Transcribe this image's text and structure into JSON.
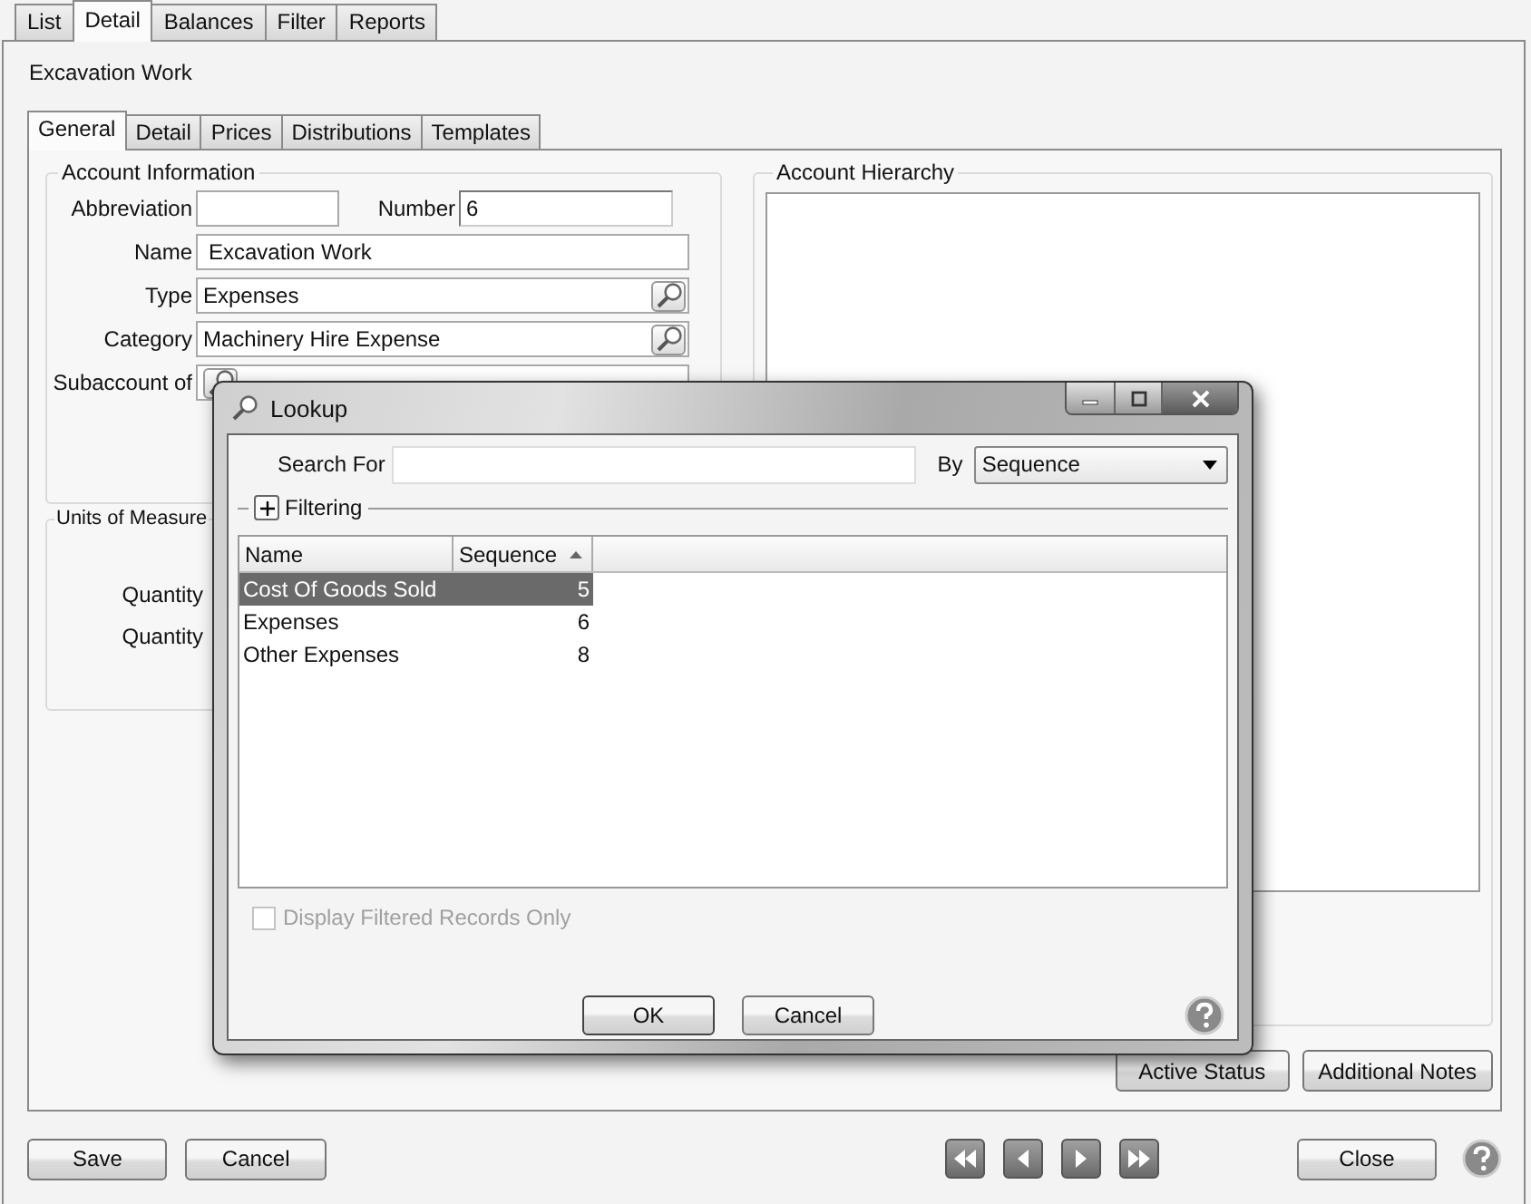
{
  "top_tabs": [
    {
      "label": "List",
      "selected": false
    },
    {
      "label": "Detail",
      "selected": true
    },
    {
      "label": "Balances",
      "selected": false
    },
    {
      "label": "Filter",
      "selected": false
    },
    {
      "label": "Reports",
      "selected": false
    }
  ],
  "record_title": "Excavation Work",
  "detail_tabs": [
    {
      "label": "General",
      "selected": true
    },
    {
      "label": "Detail",
      "selected": false
    },
    {
      "label": "Prices",
      "selected": false
    },
    {
      "label": "Distributions",
      "selected": false
    },
    {
      "label": "Templates",
      "selected": false
    }
  ],
  "account_information": {
    "title": "Account Information",
    "abbreviation": {
      "label": "Abbreviation"
    },
    "number": {
      "label": "Number",
      "value": "6"
    },
    "fields": [
      {
        "label": "Name",
        "value": "Excavation Work",
        "kind": "text"
      },
      {
        "label": "Type",
        "value": "Expenses",
        "kind": "lookup"
      },
      {
        "label": "Category",
        "value": "Machinery Hire Expense",
        "kind": "lookup"
      },
      {
        "label": "Subaccount of",
        "kind": "lookup"
      }
    ]
  },
  "units_of_measure": {
    "title": "Units of Measure",
    "labels": [
      "Quantity",
      "Quantity"
    ]
  },
  "account_hierarchy": {
    "title": "Account Hierarchy"
  },
  "side_buttons": [
    "Active Status",
    "Additional Notes"
  ],
  "footer_buttons": [
    "Save",
    "Cancel"
  ],
  "close_button": "Close",
  "lookup": {
    "title": "Lookup",
    "search_label": "Search For",
    "by_label": "By",
    "by_value": "Sequence",
    "filtering_label": "Filtering",
    "columns": [
      {
        "label": "Name",
        "sorted": false
      },
      {
        "label": "Sequence",
        "sorted": true
      }
    ],
    "rows": [
      {
        "name": "Cost Of Goods Sold",
        "sequence": "5",
        "selected": true
      },
      {
        "name": "Expenses",
        "sequence": "6",
        "selected": false
      },
      {
        "name": "Other Expenses",
        "sequence": "8",
        "selected": false
      }
    ],
    "filtered_only": {
      "label": "Display Filtered Records Only",
      "checked": false,
      "disabled": true
    },
    "buttons": [
      "OK",
      "Cancel"
    ]
  }
}
